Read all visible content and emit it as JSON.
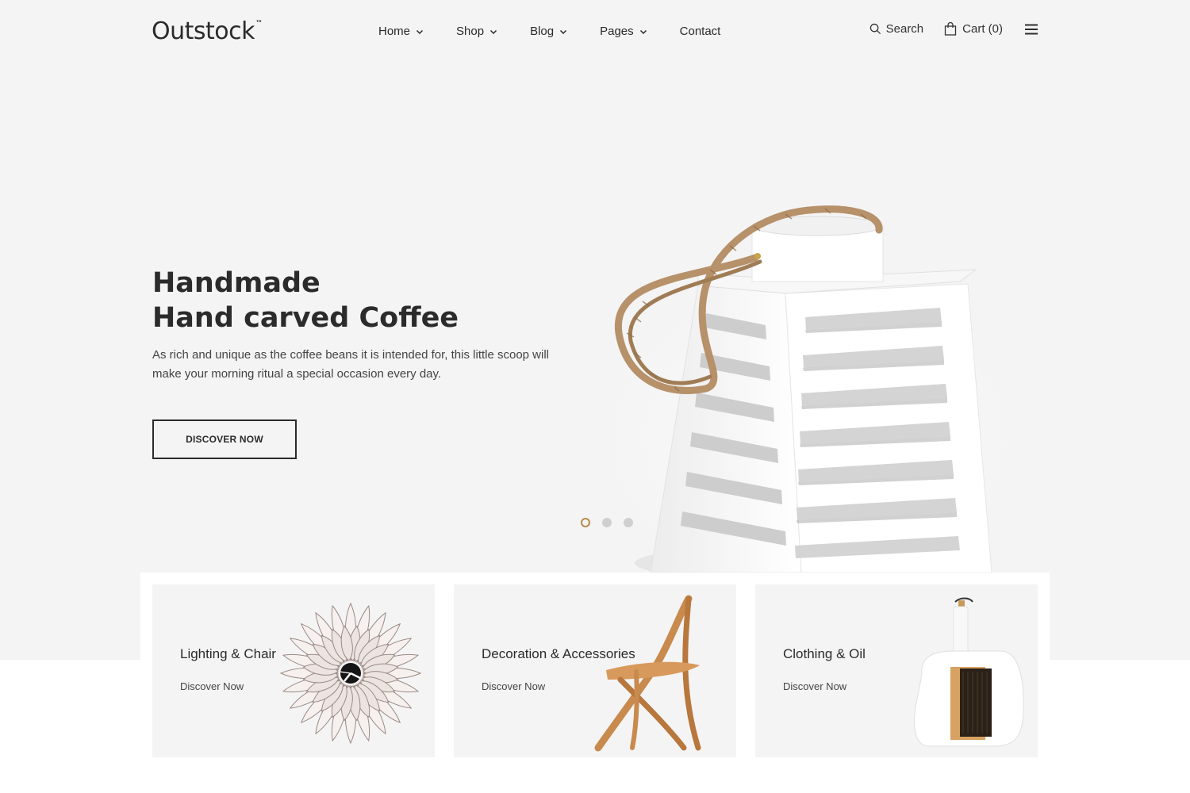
{
  "header": {
    "logo": "Outstock",
    "logo_mark": "™",
    "nav": [
      {
        "label": "Home"
      },
      {
        "label": "Shop"
      },
      {
        "label": "Blog"
      },
      {
        "label": "Pages"
      },
      {
        "label": "Contact"
      }
    ],
    "search_label": "Search",
    "cart_label": "Cart (0)"
  },
  "hero": {
    "title_line1": "Handmade",
    "title_line2": "Hand carved Coffee",
    "description": "As rich and unique as the coffee beans it is intended for, this little scoop will make your morning ritual a special occasion every day.",
    "button_label": "DISCOVER NOW",
    "slider": {
      "count": 3,
      "active_index": 0,
      "active_color": "#b98a4a"
    }
  },
  "categories": [
    {
      "title": "Lighting & Chair",
      "link": "Discover Now",
      "icon": "wall-clock"
    },
    {
      "title": "Decoration & Accessories",
      "link": "Discover Now",
      "icon": "wooden-chair"
    },
    {
      "title": "Clothing & Oil",
      "link": "Discover Now",
      "icon": "dustpan-brush"
    }
  ],
  "colors": {
    "background": "#f4f4f4",
    "text": "#2b2b2b",
    "accent": "#b98a4a"
  }
}
